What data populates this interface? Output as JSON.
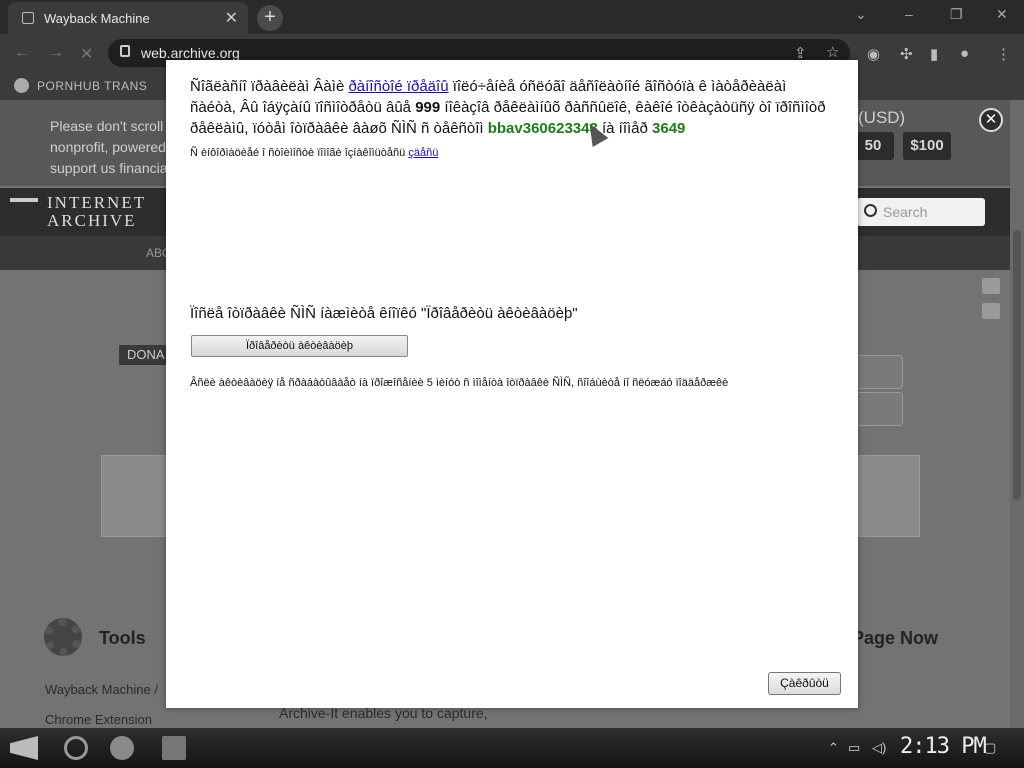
{
  "browser": {
    "tab_title": "Wayback Machine",
    "tab_close": "✕",
    "new_tab": "+",
    "url": "web.archive.org",
    "bookmark_label": "PORNHUB TRANS"
  },
  "page": {
    "banner_text": "Please don't scroll nonprofit, powered support us financia",
    "banner_currency": "(USD)",
    "amount_1": "50",
    "amount_2": "$100",
    "logo_text_1": "INTERNET",
    "logo_text_2": "ARCHIVE",
    "nav_about": "ABO",
    "search_label": "Search",
    "donate_label": "DONA",
    "tools_title": "Tools",
    "tools_link_1": "Wayback Machine /",
    "tools_link_2": "Chrome Extension",
    "save_title": "Page Now",
    "archiveit_text": "Archive-It enables you to capture,"
  },
  "modal": {
    "para_line_1": "Ñîãëàñíî ïðàâèëàì Âàìè ",
    "para_link": "ðàíîñòîé ïðåäîû",
    "para_line_1b": " ïîëó÷åíèå óñëóãî äåñîëàòíîé ãîñòóïà ê ìàòåðèàëàì ñàéòà,",
    "para_line_2a": "Âû îáÿçàíû ïîñìîòðåòü âûå ",
    "para_bold": "999",
    "para_line_2b": " íîêàçîâ ðåêëàìíûõ ðàññûëîê, êàêîé îòêàçàòüñÿ òî ïðîñìîòð ðåêëàìû,",
    "para_line_3a": "ïóòåì îòïðàâêè âàøõ ÑÌÑ ñ òåêñòîì ",
    "para_code": "bbav360623343",
    "para_line_3b": " íà íîìåð ",
    "para_number": "3649",
    "note_text": "Ñ èíôîðìàöèåé î ñòîèìîñòè ïîìîãè îçíàêîìüòåñü ",
    "note_link": "çäåñü",
    "question": "Ïîñëå îòïðàâêè ÑÌÑ íàæìèòå êíîïêó \"Ïðîâåðèòü àêòèâàöèþ\"",
    "check_button": "Ïðîâåðèòü àêòèâàöèþ",
    "hint": "Âñëè àêòèâàöèÿ íå ñðàáàòûâàåò íà ïðîæîñåíèè 5 ìèíóò ñ ìîìåíòà îòïðàâêè ÑÌÑ, ñîîáùèòå íî ñëóæáó ïîääåðæêè",
    "close_button": "Çàêðûòü"
  },
  "taskbar": {
    "clock": "2:13 PM"
  },
  "icons": {
    "tab": "page-icon",
    "lock": "lock-icon",
    "search": "search-icon",
    "gear": "gear-icon",
    "facebook": "facebook-icon",
    "twitter": "twitter-icon"
  }
}
